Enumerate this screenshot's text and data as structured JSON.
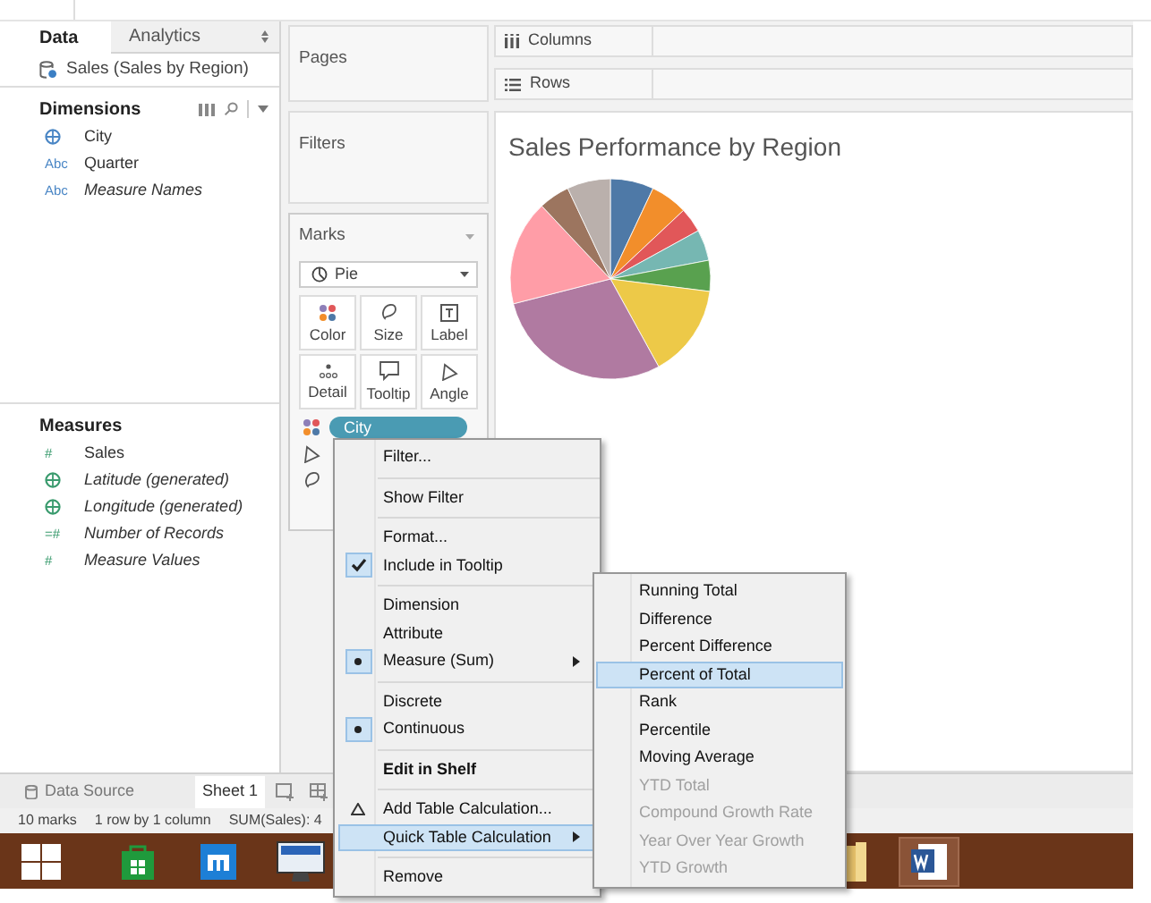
{
  "data_pane": {
    "tabs": [
      {
        "label": "Data",
        "selected": true
      },
      {
        "label": "Analytics",
        "selected": false
      }
    ],
    "source": "Sales (Sales by Region)",
    "sections": [
      {
        "title": "Dimensions",
        "kind": "dimension",
        "fields": [
          {
            "name": "City",
            "italic": false
          },
          {
            "name": "Quarter",
            "italic": false,
            "type_label": "Abc"
          },
          {
            "name": "Measure Names",
            "italic": true,
            "type_label": "Abc"
          }
        ]
      },
      {
        "title": "Measures",
        "kind": "measure",
        "fields": [
          {
            "name": "Sales",
            "italic": false,
            "type_label": "#"
          },
          {
            "name": "Latitude (generated)",
            "italic": true
          },
          {
            "name": "Longitude (generated)",
            "italic": true
          },
          {
            "name": "Number of Records",
            "italic": true,
            "type_label": "=#"
          },
          {
            "name": "Measure Values",
            "italic": true,
            "type_label": "#"
          }
        ]
      }
    ]
  },
  "pages": {
    "title": "Pages"
  },
  "filters": {
    "title": "Filters"
  },
  "marks": {
    "title": "Marks",
    "mark_type": "Pie",
    "buttons": [
      {
        "label": "Color",
        "kind": "color"
      },
      {
        "label": "Size",
        "kind": "size"
      },
      {
        "label": "Label",
        "kind": "label"
      },
      {
        "label": "Detail",
        "kind": "detail"
      },
      {
        "label": "Tooltip",
        "kind": "tooltip"
      },
      {
        "label": "Angle",
        "kind": "angle"
      }
    ],
    "pills": [
      {
        "kind": "color",
        "label": "City"
      },
      {
        "kind": "angle"
      },
      {
        "kind": "size"
      }
    ]
  },
  "shelves": [
    {
      "label": "Columns",
      "kind": "columns"
    },
    {
      "label": "Rows",
      "kind": "rows"
    }
  ],
  "view": {
    "title": "Sales Performance by Region"
  },
  "sheet_tabs": [
    {
      "label": "Data Source",
      "kind": "source",
      "selected": false
    },
    {
      "label": "Sheet 1",
      "kind": "sheet",
      "selected": true
    }
  ],
  "status_bar": [
    "10 marks",
    "1 row by 1 column",
    "SUM(Sales): 4"
  ],
  "context_menu": {
    "groups": [
      [
        {
          "label": "Filter...",
          "kind": "plain",
          "bold": false,
          "submenu": false,
          "selected": false
        }
      ],
      [
        {
          "label": "Show Filter",
          "kind": "plain",
          "bold": false,
          "submenu": false,
          "selected": false
        }
      ],
      [
        {
          "label": "Format...",
          "kind": "plain",
          "bold": false,
          "submenu": false,
          "selected": false
        },
        {
          "label": "Include in Tooltip",
          "kind": "check",
          "bold": false,
          "submenu": false,
          "selected": false
        }
      ],
      [
        {
          "label": "Dimension",
          "kind": "plain",
          "bold": false,
          "submenu": false,
          "selected": false
        },
        {
          "label": "Attribute",
          "kind": "plain",
          "bold": false,
          "submenu": false,
          "selected": false
        },
        {
          "label": "Measure (Sum)",
          "kind": "radio",
          "bold": false,
          "submenu": true,
          "selected": false
        }
      ],
      [
        {
          "label": "Discrete",
          "kind": "plain",
          "bold": false,
          "submenu": false,
          "selected": false
        },
        {
          "label": "Continuous",
          "kind": "radio",
          "bold": false,
          "submenu": false,
          "selected": false
        }
      ],
      [
        {
          "label": "Edit in Shelf",
          "kind": "plain",
          "bold": true,
          "submenu": false,
          "selected": false
        }
      ],
      [
        {
          "label": "Add Table Calculation...",
          "kind": "delta",
          "bold": false,
          "submenu": false,
          "selected": false
        },
        {
          "label": "Quick Table Calculation",
          "kind": "plain",
          "bold": false,
          "submenu": true,
          "selected": true
        }
      ],
      [
        {
          "label": "Remove",
          "kind": "plain",
          "bold": false,
          "submenu": false,
          "selected": false
        }
      ]
    ]
  },
  "submenu": {
    "items": [
      {
        "label": "Running Total",
        "disabled": false,
        "selected": false
      },
      {
        "label": "Difference",
        "disabled": false,
        "selected": false
      },
      {
        "label": "Percent Difference",
        "disabled": false,
        "selected": false
      },
      {
        "label": "Percent of Total",
        "disabled": false,
        "selected": true
      },
      {
        "label": "Rank",
        "disabled": false,
        "selected": false
      },
      {
        "label": "Percentile",
        "disabled": false,
        "selected": false
      },
      {
        "label": "Moving Average",
        "disabled": false,
        "selected": false
      },
      {
        "label": "YTD Total",
        "disabled": true,
        "selected": false
      },
      {
        "label": "Compound Growth Rate",
        "disabled": true,
        "selected": false
      },
      {
        "label": "Year Over Year Growth",
        "disabled": true,
        "selected": false
      },
      {
        "label": "YTD Growth",
        "disabled": true,
        "selected": false
      }
    ]
  }
}
